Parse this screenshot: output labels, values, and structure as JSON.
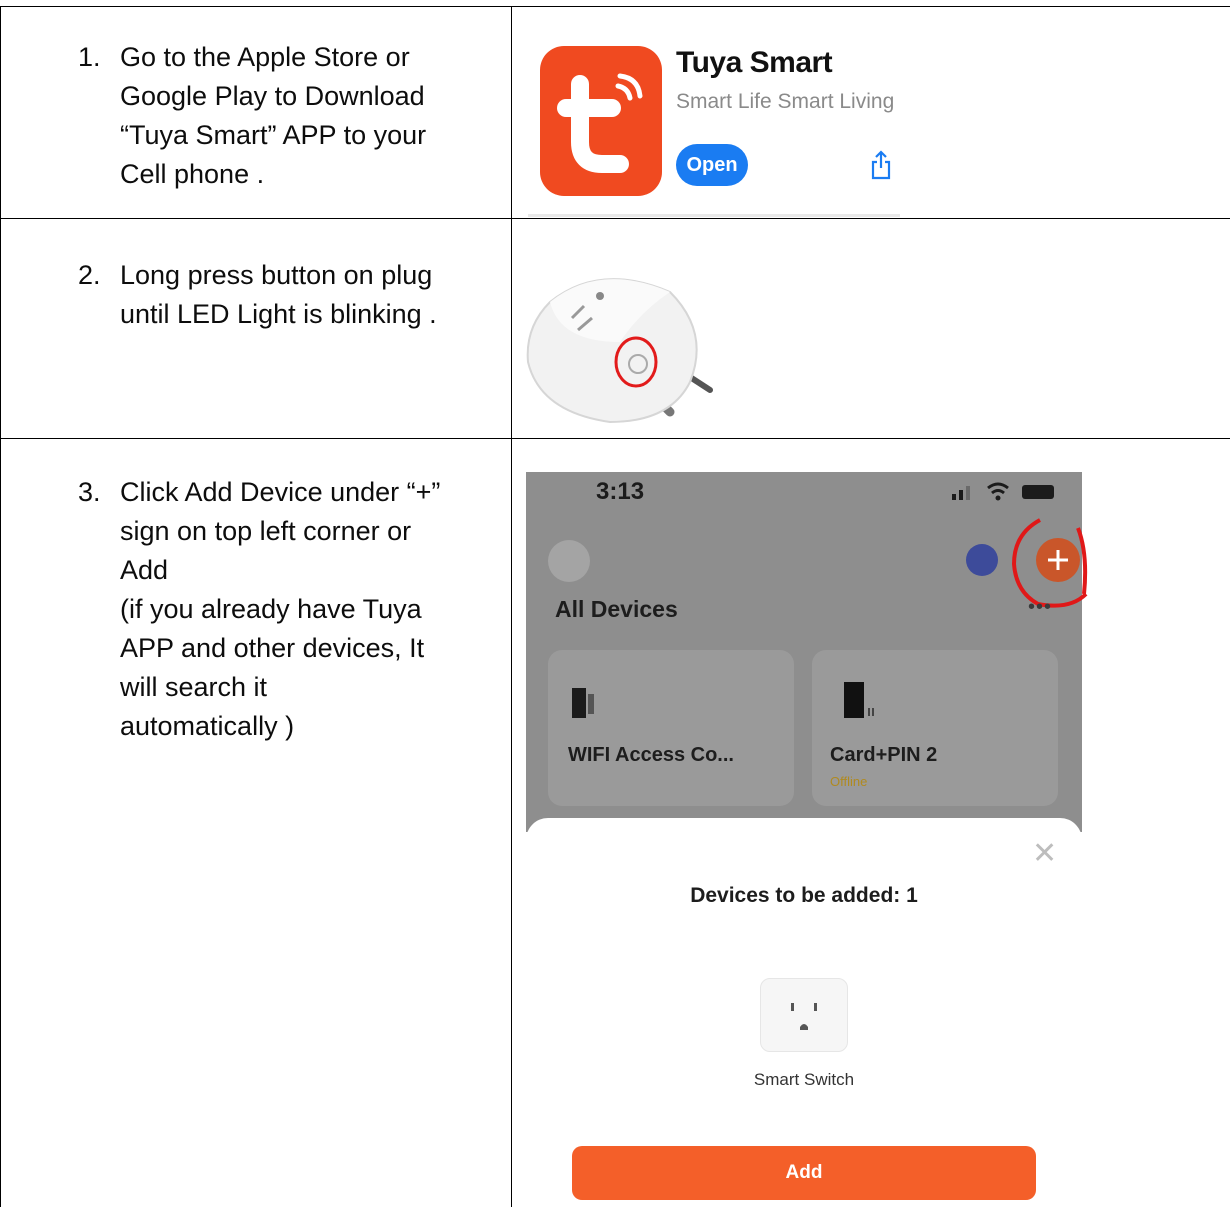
{
  "steps": [
    {
      "num": "1.",
      "lines": [
        "Go to the Apple Store or",
        "Google Play to Download",
        "“Tuya Smart” APP to your",
        "Cell phone ."
      ]
    },
    {
      "num": "2.",
      "lines": [
        "Long press button on plug",
        "until LED Light  is blinking ."
      ]
    },
    {
      "num": "3.",
      "lines": [
        "Click Add Device under “+”",
        "sign on top left corner or",
        "Add",
        "(if you already have Tuya",
        "APP and other devices, It",
        "will search it",
        "automatically )"
      ]
    }
  ],
  "app_store": {
    "app_name": "Tuya Smart",
    "subtitle": "Smart Life Smart Living",
    "open_label": "Open",
    "icon_color": "#f04a20",
    "button_color": "#1a7cf2"
  },
  "phone": {
    "time": "3:13",
    "section_title": "All Devices",
    "more": "•••",
    "devices": [
      {
        "name": "WIFI Access Co..."
      },
      {
        "name": "Card+PIN 2",
        "status": "Offline"
      }
    ],
    "sheet": {
      "title": "Devices to be added: 1",
      "device_name": "Smart Switch",
      "add_label": "Add",
      "close": "✕",
      "accent_color": "#f45f29"
    }
  }
}
